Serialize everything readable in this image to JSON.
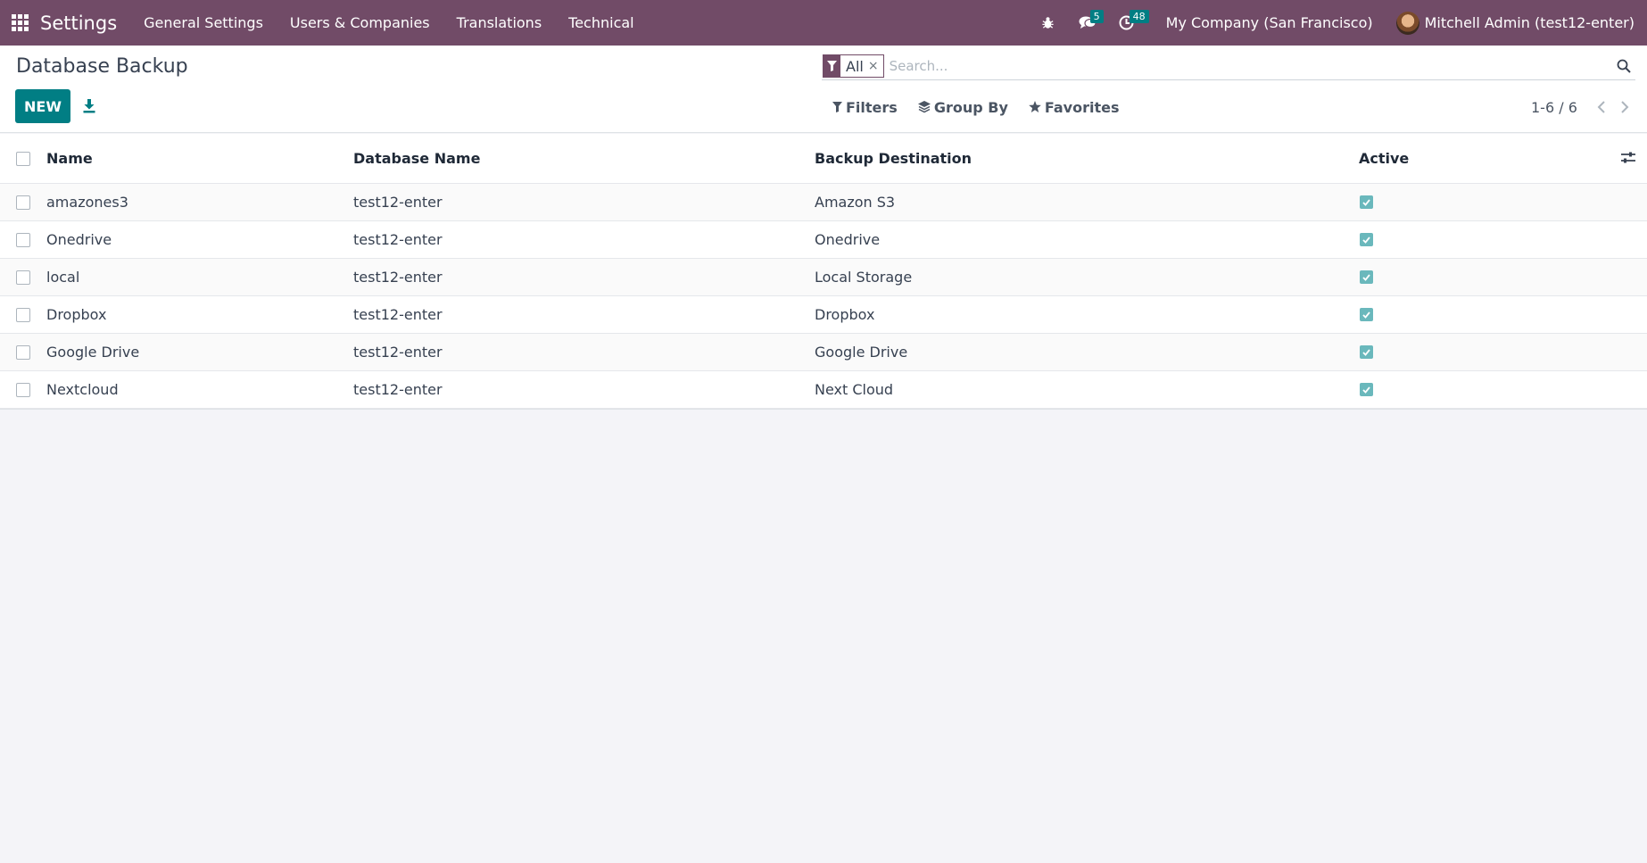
{
  "navbar": {
    "app_name": "Settings",
    "menu": [
      {
        "label": "General Settings"
      },
      {
        "label": "Users & Companies"
      },
      {
        "label": "Translations"
      },
      {
        "label": "Technical"
      }
    ],
    "messages_count": "5",
    "activities_count": "48",
    "company": "My Company (San Francisco)",
    "user": "Mitchell Admin (test12-enter)",
    "colors": {
      "bar": "#714b67",
      "badge": "#017e84"
    }
  },
  "control_panel": {
    "title": "Database Backup",
    "new_label": "NEW",
    "search": {
      "facet_value": "All",
      "facet_close": "×",
      "placeholder": "Search..."
    },
    "filters_label": "Filters",
    "group_by_label": "Group By",
    "favorites_label": "Favorites",
    "pager_value": "1-6 / 6"
  },
  "list": {
    "columns": {
      "name": "Name",
      "database_name": "Database Name",
      "backup_destination": "Backup Destination",
      "active": "Active"
    },
    "rows": [
      {
        "name": "amazones3",
        "database_name": "test12-enter",
        "backup_destination": "Amazon S3",
        "active": true
      },
      {
        "name": "Onedrive",
        "database_name": "test12-enter",
        "backup_destination": "Onedrive",
        "active": true
      },
      {
        "name": "local",
        "database_name": "test12-enter",
        "backup_destination": "Local Storage",
        "active": true
      },
      {
        "name": "Dropbox",
        "database_name": "test12-enter",
        "backup_destination": "Dropbox",
        "active": true
      },
      {
        "name": "Google Drive",
        "database_name": "test12-enter",
        "backup_destination": "Google Drive",
        "active": true
      },
      {
        "name": "Nextcloud",
        "database_name": "test12-enter",
        "backup_destination": "Next Cloud",
        "active": true
      }
    ]
  }
}
